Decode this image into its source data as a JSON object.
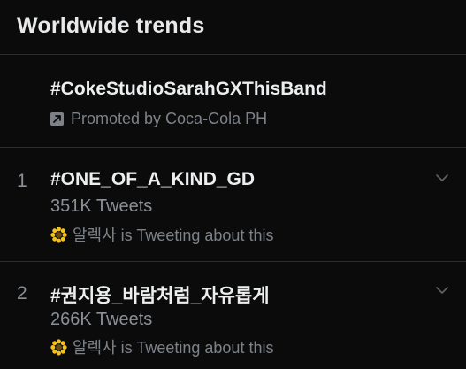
{
  "header": {
    "title": "Worldwide trends"
  },
  "promoted": {
    "hashtag": "#CokeStudioSarahGXThisBand",
    "promo_text": "Promoted by Coca-Cola PH",
    "icon": "promoted-arrow-icon"
  },
  "trends": [
    {
      "rank": "1",
      "hashtag": "#ONE_OF_A_KIND_GD",
      "count": "351K Tweets",
      "context": "알렉사 is Tweeting about this",
      "avatar_icon": "sunflower-avatar-icon",
      "menu_icon": "chevron-down-icon"
    },
    {
      "rank": "2",
      "hashtag": "#권지용_바람처럼_자유롭게",
      "count": "266K Tweets",
      "context": "알렉사 is Tweeting about this",
      "avatar_icon": "sunflower-avatar-icon",
      "menu_icon": "chevron-down-icon"
    }
  ],
  "colors": {
    "background": "#0b0b0b",
    "primary_text": "#e7e9ea",
    "secondary_text": "#8b9096",
    "divider": "#2a2d30",
    "avatar_yellow": "#f2c21b"
  }
}
